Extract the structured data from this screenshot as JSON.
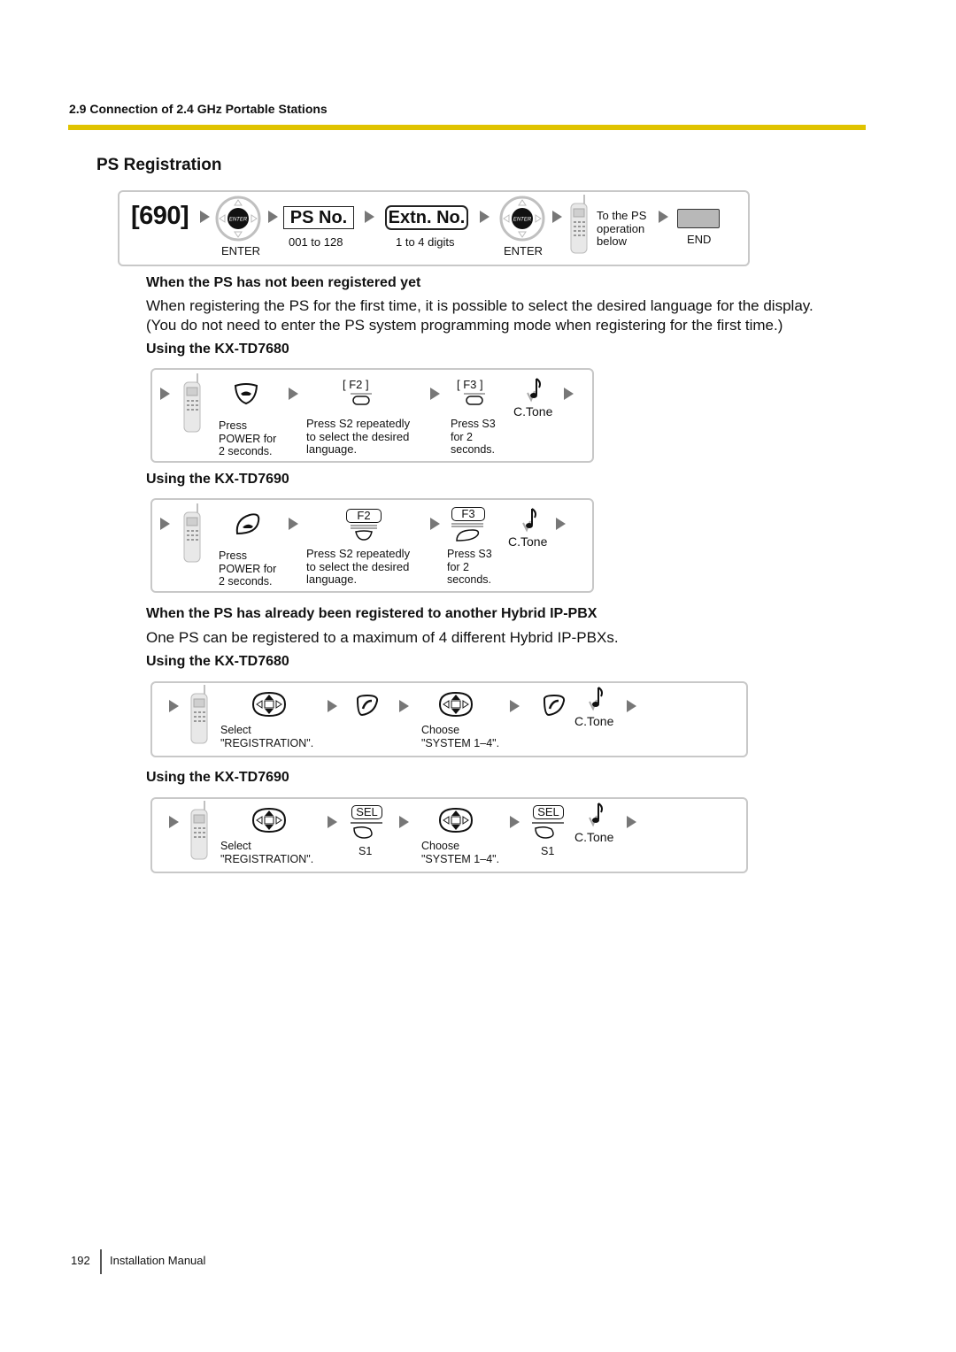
{
  "header": {
    "section": "2.9 Connection of 2.4 GHz Portable Stations",
    "title": "PS Registration"
  },
  "command_flow": {
    "code": "[690]",
    "enter_label_1": "ENTER",
    "ps_no_key": "PS No.",
    "ps_no_range": "001 to 128",
    "extn_key": "Extn. No.",
    "extn_range": "1 to 4 digits",
    "enter_label_2": "ENTER",
    "to_ps_line1": "To the PS",
    "to_ps_line2": "operation",
    "to_ps_line3": "below",
    "end_label": "END",
    "enter_icon_text": "ENTER"
  },
  "not_registered": {
    "heading": "When the PS has not been registered yet",
    "para_line1": "When registering the PS for the first time, it is possible to select the desired language for the display.",
    "para_line2": "(You do not need to enter the PS system programming mode when registering for the first time.)",
    "td7680": {
      "heading": "Using the KX-TD7680",
      "power_l1": "Press",
      "power_l2": "POWER for",
      "power_l3": "2 seconds.",
      "f2": "[ F2 ]",
      "s2_l1": "Press S2 repeatedly",
      "s2_l2": "to select the desired",
      "s2_l3": "language.",
      "f3": "[ F3 ]",
      "s3_l1": "Press S3",
      "s3_l2": "for 2",
      "s3_l3": "seconds.",
      "ctone": "C.Tone"
    },
    "td7690": {
      "heading": "Using the KX-TD7690",
      "power_l1": "Press",
      "power_l2": "POWER for",
      "power_l3": "2 seconds.",
      "f2": "F2",
      "s2_l1": "Press S2 repeatedly",
      "s2_l2": "to select the desired",
      "s2_l3": "language.",
      "f3": "F3",
      "s3_l1": "Press S3",
      "s3_l2": "for 2",
      "s3_l3": "seconds.",
      "ctone": "C.Tone"
    }
  },
  "already_registered": {
    "heading": "When the PS has already been registered to another Hybrid IP-PBX",
    "para": "One PS can be registered to a maximum of 4 different Hybrid IP-PBXs.",
    "td7680": {
      "heading": "Using the KX-TD7680",
      "select_l1": "Select",
      "select_l2": "\"REGISTRATION\".",
      "choose_l1": "Choose",
      "choose_l2": "\"SYSTEM 1–4\".",
      "ctone": "C.Tone"
    },
    "td7690": {
      "heading": "Using the KX-TD7690",
      "select_l1": "Select",
      "select_l2": "\"REGISTRATION\".",
      "sel_1": "SEL",
      "s1_1": "S1",
      "choose_l1": "Choose",
      "choose_l2": "\"SYSTEM 1–4\".",
      "sel_2": "SEL",
      "s1_2": "S1",
      "ctone": "C.Tone"
    }
  },
  "footer": {
    "page_number": "192",
    "manual": "Installation Manual"
  },
  "colors": {
    "rule": "#e0c300",
    "arrow": "#777777",
    "box_border": "#c8c8c8",
    "end_button": "#b8b8b8"
  }
}
